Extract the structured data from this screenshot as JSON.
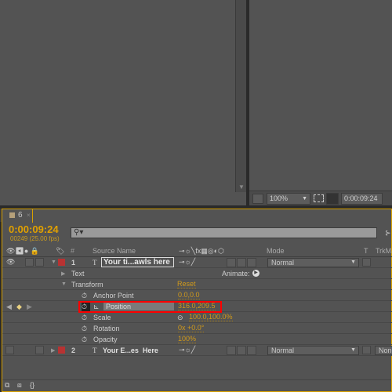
{
  "viewer": {
    "zoom": "100%",
    "timecode": "0:00:09:24"
  },
  "timeline": {
    "tab_label": "6",
    "current_time": "0:00:09:24",
    "frame_info": "00249 (25.00 fps)",
    "columns": {
      "number": "#",
      "source_name": "Source Name",
      "mode": "Mode",
      "t": "T",
      "trkmat": "TrkMat"
    },
    "layers": [
      {
        "index": "1",
        "name": "Your ti...awls here",
        "mode": "Normal",
        "color": "#b83232"
      },
      {
        "index": "2",
        "name": "Your E...es  Here",
        "mode": "Normal",
        "trkmat": "None",
        "color": "#b83232"
      }
    ],
    "properties": {
      "text": "Text",
      "animate": "Animate:",
      "transform": "Transform",
      "reset": "Reset",
      "anchor_point": {
        "label": "Anchor Point",
        "value": "0.0,0.0"
      },
      "position": {
        "label": "Position",
        "value": "316.0,209.5"
      },
      "scale": {
        "label": "Scale",
        "value": "100.0,100.0%"
      },
      "rotation": {
        "label": "Rotation",
        "value": "0x +0.0°"
      },
      "opacity": {
        "label": "Opacity",
        "value": "100%"
      }
    },
    "highlight_color": "#ff0000"
  }
}
